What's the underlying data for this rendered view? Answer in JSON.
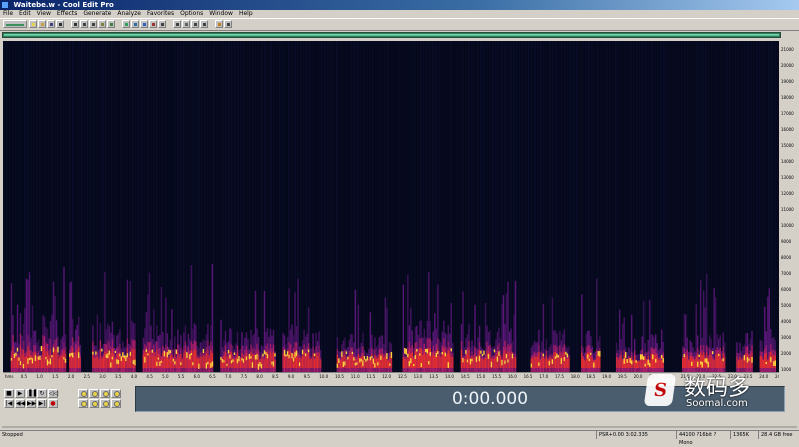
{
  "window": {
    "title": "Waitebe.w - Cool Edit Pro"
  },
  "menu": [
    "File",
    "Edit",
    "View",
    "Effects",
    "Generate",
    "Analyze",
    "Favorites",
    "Options",
    "Window",
    "Help"
  ],
  "toolbar": {
    "buttons": [
      {
        "icon": "waveform-view-icon",
        "color": "#3a8f5a"
      },
      {
        "icon": "new-file-icon",
        "color": "#e8d24a"
      },
      {
        "icon": "open-file-icon",
        "color": "#c8a040"
      },
      {
        "icon": "save-icon",
        "color": "#404080"
      },
      {
        "icon": "undo-icon",
        "color": "#303030"
      },
      {
        "icon": "redo-icon",
        "color": "#303030"
      },
      {
        "icon": "cut-icon",
        "color": "#404040"
      },
      {
        "icon": "copy-icon",
        "color": "#404040"
      },
      {
        "icon": "paste-icon",
        "color": "#808040"
      },
      {
        "icon": "mix-paste-icon",
        "color": "#408040"
      },
      {
        "icon": "effects-icon",
        "color": "#30a060"
      },
      {
        "icon": "noise-icon",
        "color": "#2a6fa0"
      },
      {
        "icon": "spectrum-icon",
        "color": "#3060c0"
      },
      {
        "icon": "marker-icon",
        "color": "#a03030"
      },
      {
        "icon": "track-icon",
        "color": "#404040"
      },
      {
        "icon": "multitrack-icon",
        "color": "#404040"
      },
      {
        "icon": "cd-icon",
        "color": "#606060"
      },
      {
        "icon": "settings-icon",
        "color": "#404040"
      },
      {
        "icon": "frequency-icon",
        "color": "#404040"
      },
      {
        "icon": "spectral-view-icon",
        "color": "#c08020"
      },
      {
        "icon": "info-icon",
        "color": "#404040"
      }
    ]
  },
  "spectrogram": {
    "frequency_labels": [
      "21000",
      "20000",
      "19000",
      "18000",
      "17000",
      "16000",
      "15000",
      "14000",
      "13000",
      "12000",
      "11000",
      "10000",
      "9000",
      "8000",
      "7000",
      "6000",
      "5000",
      "4000",
      "3000",
      "2000",
      "1000"
    ],
    "time_labels": [
      "hms",
      "0.5",
      "1.0",
      "1.5",
      "2.0",
      "2.5",
      "3.0",
      "3.5",
      "4.0",
      "4.5",
      "5.0",
      "5.5",
      "6.0",
      "6.5",
      "7.0",
      "7.5",
      "8.0",
      "8.5",
      "9.0",
      "9.5",
      "10.0",
      "10.5",
      "11.0",
      "11.5",
      "12.0",
      "12.5",
      "13.0",
      "13.5",
      "14.0",
      "14.5",
      "15.0",
      "15.5",
      "16.0",
      "16.5",
      "17.0",
      "17.5",
      "18.0",
      "18.5",
      "19.0",
      "19.5",
      "20.0",
      "20.5",
      "21.0",
      "21.5",
      "22.0",
      "22.5",
      "23.0",
      "23.5",
      "24.0",
      "24.5"
    ],
    "speech_bursts": [
      {
        "start": 0.01,
        "end": 0.08,
        "level": 0.85
      },
      {
        "start": 0.085,
        "end": 0.1,
        "level": 0.8
      },
      {
        "start": 0.115,
        "end": 0.17,
        "level": 0.75
      },
      {
        "start": 0.18,
        "end": 0.27,
        "level": 0.7
      },
      {
        "start": 0.28,
        "end": 0.35,
        "level": 0.65
      },
      {
        "start": 0.36,
        "end": 0.41,
        "level": 0.7
      },
      {
        "start": 0.43,
        "end": 0.5,
        "level": 0.6
      },
      {
        "start": 0.515,
        "end": 0.58,
        "level": 0.75
      },
      {
        "start": 0.59,
        "end": 0.66,
        "level": 0.7
      },
      {
        "start": 0.68,
        "end": 0.73,
        "level": 0.65
      },
      {
        "start": 0.745,
        "end": 0.77,
        "level": 0.6
      },
      {
        "start": 0.79,
        "end": 0.85,
        "level": 0.55
      },
      {
        "start": 0.875,
        "end": 0.93,
        "level": 0.6
      },
      {
        "start": 0.945,
        "end": 0.965,
        "level": 0.6
      },
      {
        "start": 0.975,
        "end": 0.995,
        "level": 0.65
      }
    ]
  },
  "transport": {
    "row1": [
      "■",
      "▶",
      "▐▐",
      "↻",
      "◁◁"
    ],
    "row2": [
      "|◀",
      "◀◀",
      "▶▶",
      "▶|",
      "●"
    ]
  },
  "zoom": [
    "zoom-in-horizontal-icon",
    "zoom-out-horizontal-icon",
    "zoom-full-icon",
    "zoom-in-vertical-icon",
    "zoom-selection-icon",
    "zoom-left-icon",
    "zoom-right-icon",
    "zoom-out-vertical-icon"
  ],
  "time_display": {
    "value": "0:00.000"
  },
  "status_bar": {
    "state": "Stopped",
    "level": "PSR+0.00 3:02.335",
    "format": "44100 ?16bit ?Mono",
    "size": "1365K",
    "free": "28.4 GB free"
  },
  "watermark": {
    "brand": "数码多",
    "url": "Soomal.com",
    "logo_letter": "S"
  }
}
